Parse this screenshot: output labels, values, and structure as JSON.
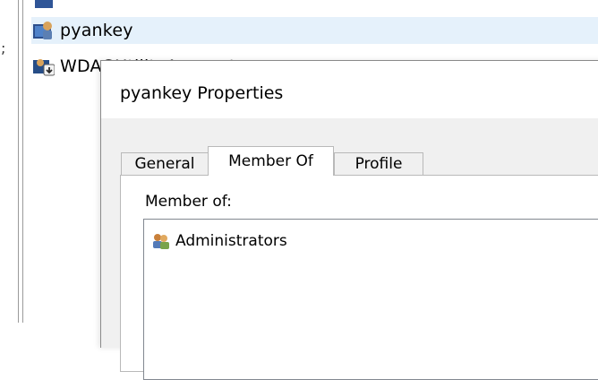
{
  "users_list": {
    "items": [
      {
        "label": "pyankey",
        "selected": true,
        "icon": "user-icon"
      },
      {
        "label": "WDAGUtilityAccount",
        "selected": false,
        "icon": "disabled-user-icon"
      }
    ],
    "left_edge_glyph": ";"
  },
  "dialog": {
    "title": "pyankey Properties",
    "tabs": [
      {
        "label": "General",
        "active": false
      },
      {
        "label": "Member Of",
        "active": true
      },
      {
        "label": "Profile",
        "active": false
      }
    ],
    "member_of": {
      "label": "Member of:",
      "groups": [
        {
          "name": "Administrators",
          "icon": "group-icon"
        }
      ]
    }
  },
  "colors": {
    "selection": "#e5f1fb",
    "dialog_face": "#f0f0f0",
    "border": "#b9b9b9"
  }
}
